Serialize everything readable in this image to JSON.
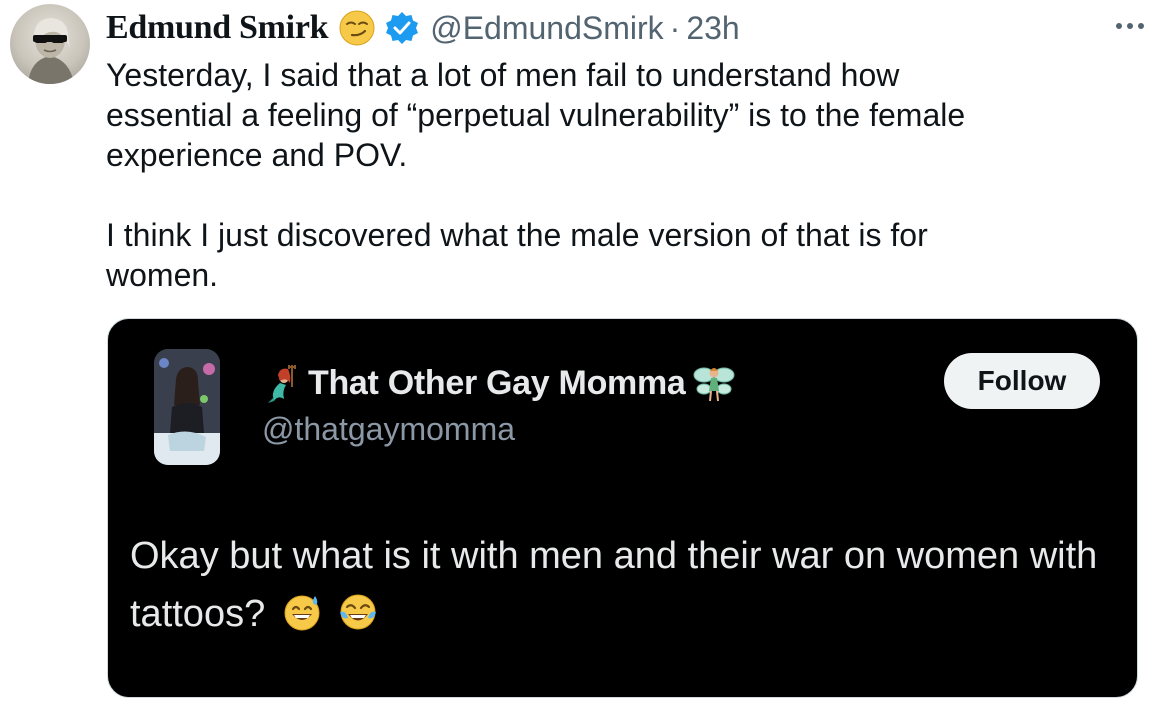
{
  "tweet": {
    "author_name": "Edmund Smirk",
    "author_handle": "@EdmundSmirk",
    "separator": "·",
    "time": "23h",
    "text": "Yesterday, I said that a lot of men fail to understand how\nessential a feeling of “perpetual vulnerability” is to the female\nexperience and POV.\n\nI think I just discovered what the male version of that is for\nwomen.",
    "icons": [
      "smirk-emoji",
      "verified-icon",
      "more-icon"
    ]
  },
  "quote": {
    "author_name": "That Other Gay Momma",
    "author_handle": "@thatgaymomma",
    "follow_label": "Follow",
    "text": "Okay but what is it with men and their war on women with tattoos?",
    "icons": [
      "mermaid-icon",
      "fairy-icon",
      "sweat-smile-emoji",
      "tears-of-joy-emoji"
    ]
  },
  "colors": {
    "text": "#0f1419",
    "secondary": "#536471",
    "verified": "#1d9bf0",
    "card_bg": "#000000",
    "card_text": "#e7e9ea",
    "follow_bg": "#eff3f4"
  }
}
